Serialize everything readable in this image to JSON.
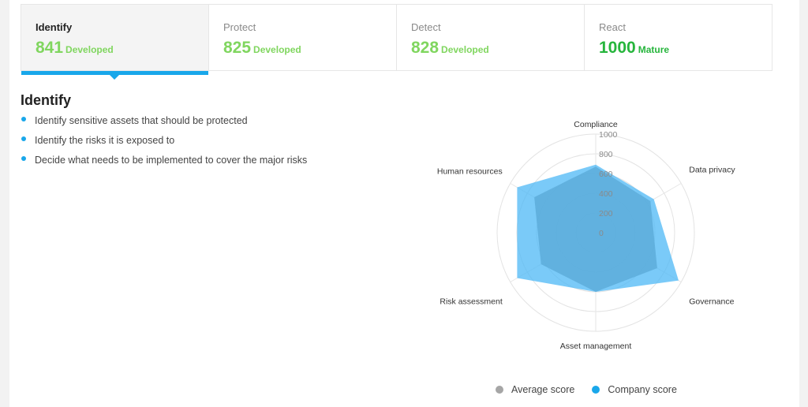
{
  "tabs": [
    {
      "name": "Identify",
      "score": "841",
      "level": "Developed"
    },
    {
      "name": "Protect",
      "score": "825",
      "level": "Developed"
    },
    {
      "name": "Detect",
      "score": "828",
      "level": "Developed"
    },
    {
      "name": "React",
      "score": "1000",
      "level": "Mature"
    }
  ],
  "active_tab": "Identify",
  "section": {
    "title": "Identify",
    "bullets": [
      "Identify sensitive assets that should be protected",
      "Identify the risks it is exposed to",
      "Decide what needs to be implemented to cover the major risks"
    ]
  },
  "colors": {
    "accent": "#19a7ea",
    "developed": "#80d65f",
    "mature": "#26b53c",
    "average_fill": "#8c8c8c",
    "company_fill": "#4db8f5"
  },
  "chart_data": {
    "type": "radar",
    "axes": [
      "Compliance",
      "Data privacy",
      "Governance",
      "Asset management",
      "Risk assessment",
      "Human resources"
    ],
    "rlim": [
      0,
      1000
    ],
    "ticks": [
      "0",
      "200",
      "400",
      "600",
      "800",
      "1000"
    ],
    "grid": true,
    "legend_position": "bottom",
    "series": [
      {
        "name": "Average score",
        "color": "#a6a6a6",
        "values": [
          670,
          640,
          720,
          600,
          640,
          720
        ]
      },
      {
        "name": "Company score",
        "color": "#19a7ea",
        "values": [
          690,
          680,
          970,
          600,
          920,
          920
        ]
      }
    ]
  }
}
